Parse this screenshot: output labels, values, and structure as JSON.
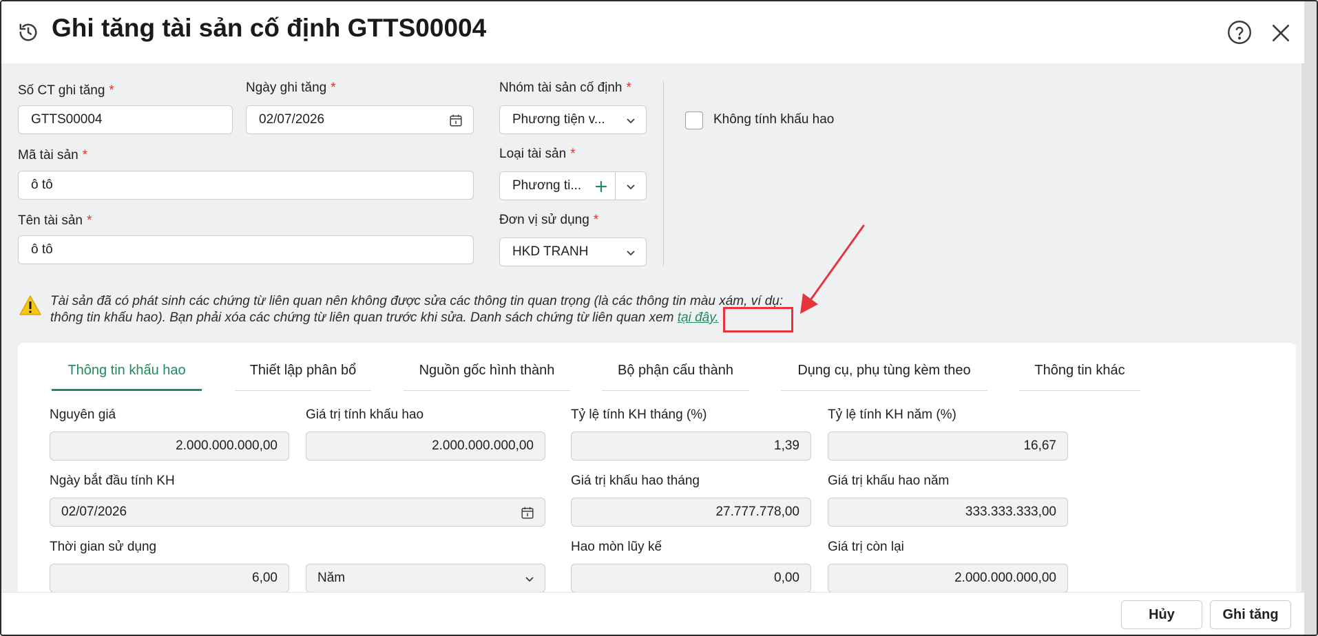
{
  "header": {
    "title": "Ghi tăng tài sản cố định GTTS00004"
  },
  "form": {
    "so_ct": {
      "label": "Số CT ghi tăng",
      "value": "GTTS00004"
    },
    "ngay_ghi_tang": {
      "label": "Ngày ghi tăng",
      "value": "02/07/2026"
    },
    "nhom_tai_san": {
      "label": "Nhóm tài sản cố định",
      "value": "Phương tiện v..."
    },
    "khong_tinh_khau_hao": {
      "label": "Không tính khấu hao",
      "checked": false
    },
    "ma_tai_san": {
      "label": "Mã tài sản",
      "value": "ô tô"
    },
    "loai_tai_san": {
      "label": "Loại tài sản",
      "value": "Phương ti..."
    },
    "ten_tai_san": {
      "label": "Tên tài sản",
      "value": "ô tô"
    },
    "don_vi_su_dung": {
      "label": "Đơn vị sử dụng",
      "value": "HKD TRANH"
    },
    "required_mark": "*"
  },
  "warning": {
    "line1": "Tài sản đã có phát sinh các chứng từ liên quan nên không được sửa các thông tin quan trọng (là các thông tin màu xám, ví dụ:",
    "line2": "thông tin khấu hao). Bạn phải xóa các chứng từ liên quan trước khi sửa. Danh sách chứng từ liên quan xem ",
    "link": "tại đây."
  },
  "tabs": [
    {
      "label": "Thông tin khấu hao",
      "active": true
    },
    {
      "label": "Thiết lập phân bổ",
      "active": false
    },
    {
      "label": "Nguồn gốc hình thành",
      "active": false
    },
    {
      "label": "Bộ phận cấu thành",
      "active": false
    },
    {
      "label": "Dụng cụ, phụ tùng kèm theo",
      "active": false
    },
    {
      "label": "Thông tin khác",
      "active": false
    }
  ],
  "depreciation": {
    "nguyen_gia": {
      "label": "Nguyên giá",
      "value": "2.000.000.000,00"
    },
    "gia_tri_tinh_kh": {
      "label": "Giá trị tính khấu hao",
      "value": "2.000.000.000,00"
    },
    "ty_le_thang": {
      "label": "Tỷ lệ tính KH tháng (%)",
      "value": "1,39"
    },
    "ty_le_nam": {
      "label": "Tỷ lệ tính KH năm (%)",
      "value": "16,67"
    },
    "ngay_bat_dau": {
      "label": "Ngày bắt đầu tính KH",
      "value": "02/07/2026"
    },
    "gia_tri_kh_thang": {
      "label": "Giá trị khấu hao tháng",
      "value": "27.777.778,00"
    },
    "gia_tri_kh_nam": {
      "label": "Giá trị khấu hao năm",
      "value": "333.333.333,00"
    },
    "thoi_gian_su_dung": {
      "label": "Thời gian sử dụng",
      "value": "6,00",
      "unit": "Năm"
    },
    "hao_mon_luy_ke": {
      "label": "Hao mòn lũy kế",
      "value": "0,00"
    },
    "gia_tri_con_lai": {
      "label": "Giá trị còn lại",
      "value": "2.000.000.000,00"
    }
  },
  "footer": {
    "cancel": "Hủy",
    "submit": "Ghi tăng"
  },
  "colors": {
    "accent": "#1f8a5b",
    "required": "#e0312b",
    "annotation": "#e5343b"
  }
}
